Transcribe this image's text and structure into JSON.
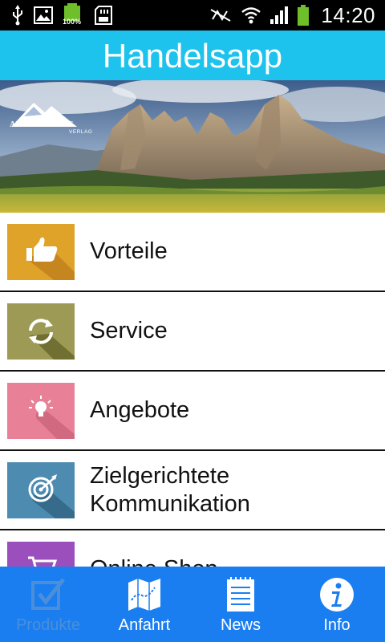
{
  "status_bar": {
    "battery_level": "100%",
    "time": "14:20"
  },
  "app": {
    "title": "Handelsapp"
  },
  "banner": {
    "logo_text_1": "ALPEN",
    "logo_text_2": "WELT",
    "logo_text_3": "VERLAG"
  },
  "menu": {
    "items": [
      {
        "label": "Vorteile",
        "icon": "thumbs-up-icon",
        "color": "#e0a32a"
      },
      {
        "label": "Service",
        "icon": "refresh-icon",
        "color": "#9c9a55"
      },
      {
        "label": "Angebote",
        "icon": "lightbulb-icon",
        "color": "#e88197"
      },
      {
        "label": "Zielgerichtete Kommunikation",
        "icon": "target-icon",
        "color": "#4d8cb0"
      },
      {
        "label": "Online Shop",
        "icon": "cart-icon",
        "color": "#9b4fbd"
      }
    ]
  },
  "bottom_nav": {
    "items": [
      {
        "label": "Produkte",
        "icon": "checkbox-icon",
        "active": true
      },
      {
        "label": "Anfahrt",
        "icon": "map-icon",
        "active": false
      },
      {
        "label": "News",
        "icon": "notepad-icon",
        "active": false
      },
      {
        "label": "Info",
        "icon": "info-icon",
        "active": false
      }
    ]
  },
  "colors": {
    "header": "#1ec3ed",
    "bottom_nav": "#1a7ef0",
    "status_bar": "#000000"
  }
}
